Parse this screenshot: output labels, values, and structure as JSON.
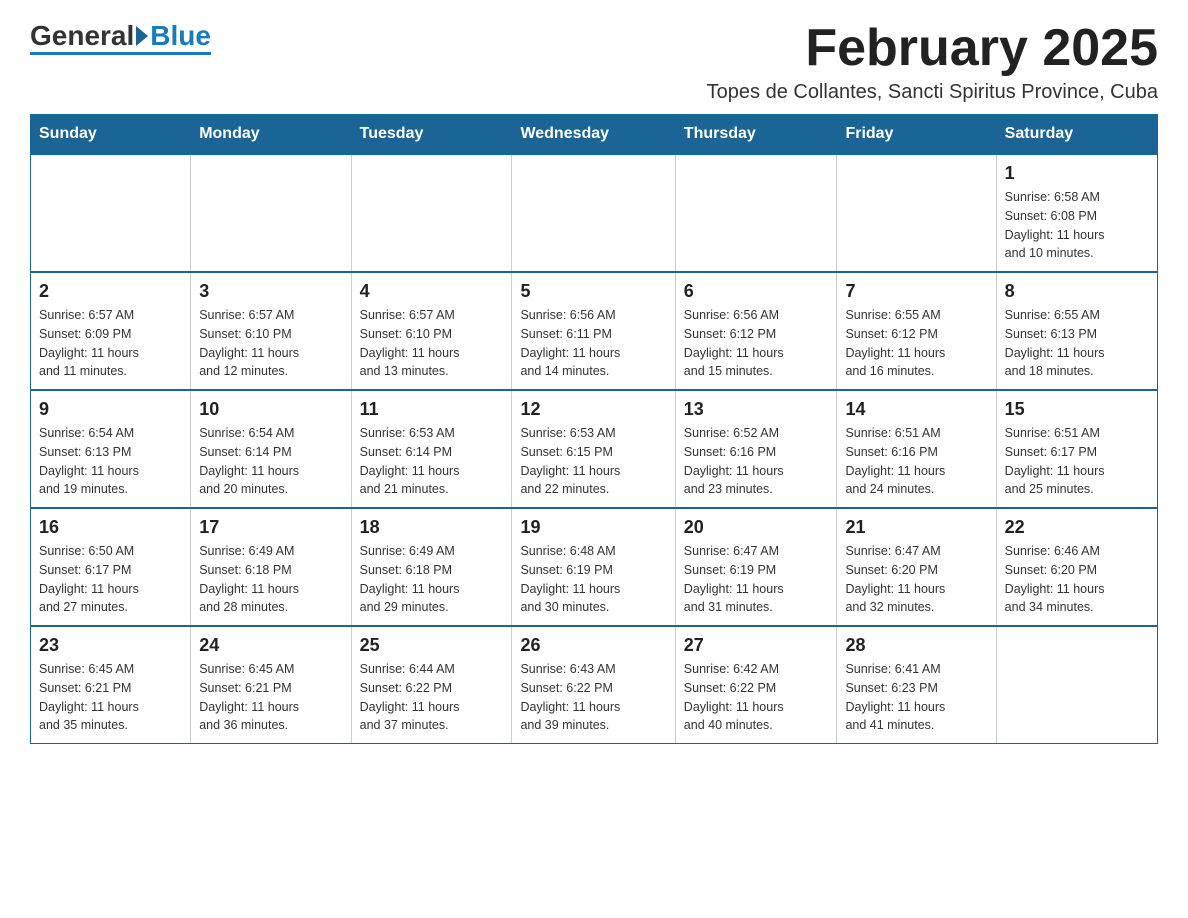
{
  "logo": {
    "general": "General",
    "blue": "Blue"
  },
  "header": {
    "month_title": "February 2025",
    "location": "Topes de Collantes, Sancti Spiritus Province, Cuba"
  },
  "weekdays": [
    "Sunday",
    "Monday",
    "Tuesday",
    "Wednesday",
    "Thursday",
    "Friday",
    "Saturday"
  ],
  "weeks": [
    [
      {
        "day": "",
        "info": ""
      },
      {
        "day": "",
        "info": ""
      },
      {
        "day": "",
        "info": ""
      },
      {
        "day": "",
        "info": ""
      },
      {
        "day": "",
        "info": ""
      },
      {
        "day": "",
        "info": ""
      },
      {
        "day": "1",
        "info": "Sunrise: 6:58 AM\nSunset: 6:08 PM\nDaylight: 11 hours\nand 10 minutes."
      }
    ],
    [
      {
        "day": "2",
        "info": "Sunrise: 6:57 AM\nSunset: 6:09 PM\nDaylight: 11 hours\nand 11 minutes."
      },
      {
        "day": "3",
        "info": "Sunrise: 6:57 AM\nSunset: 6:10 PM\nDaylight: 11 hours\nand 12 minutes."
      },
      {
        "day": "4",
        "info": "Sunrise: 6:57 AM\nSunset: 6:10 PM\nDaylight: 11 hours\nand 13 minutes."
      },
      {
        "day": "5",
        "info": "Sunrise: 6:56 AM\nSunset: 6:11 PM\nDaylight: 11 hours\nand 14 minutes."
      },
      {
        "day": "6",
        "info": "Sunrise: 6:56 AM\nSunset: 6:12 PM\nDaylight: 11 hours\nand 15 minutes."
      },
      {
        "day": "7",
        "info": "Sunrise: 6:55 AM\nSunset: 6:12 PM\nDaylight: 11 hours\nand 16 minutes."
      },
      {
        "day": "8",
        "info": "Sunrise: 6:55 AM\nSunset: 6:13 PM\nDaylight: 11 hours\nand 18 minutes."
      }
    ],
    [
      {
        "day": "9",
        "info": "Sunrise: 6:54 AM\nSunset: 6:13 PM\nDaylight: 11 hours\nand 19 minutes."
      },
      {
        "day": "10",
        "info": "Sunrise: 6:54 AM\nSunset: 6:14 PM\nDaylight: 11 hours\nand 20 minutes."
      },
      {
        "day": "11",
        "info": "Sunrise: 6:53 AM\nSunset: 6:14 PM\nDaylight: 11 hours\nand 21 minutes."
      },
      {
        "day": "12",
        "info": "Sunrise: 6:53 AM\nSunset: 6:15 PM\nDaylight: 11 hours\nand 22 minutes."
      },
      {
        "day": "13",
        "info": "Sunrise: 6:52 AM\nSunset: 6:16 PM\nDaylight: 11 hours\nand 23 minutes."
      },
      {
        "day": "14",
        "info": "Sunrise: 6:51 AM\nSunset: 6:16 PM\nDaylight: 11 hours\nand 24 minutes."
      },
      {
        "day": "15",
        "info": "Sunrise: 6:51 AM\nSunset: 6:17 PM\nDaylight: 11 hours\nand 25 minutes."
      }
    ],
    [
      {
        "day": "16",
        "info": "Sunrise: 6:50 AM\nSunset: 6:17 PM\nDaylight: 11 hours\nand 27 minutes."
      },
      {
        "day": "17",
        "info": "Sunrise: 6:49 AM\nSunset: 6:18 PM\nDaylight: 11 hours\nand 28 minutes."
      },
      {
        "day": "18",
        "info": "Sunrise: 6:49 AM\nSunset: 6:18 PM\nDaylight: 11 hours\nand 29 minutes."
      },
      {
        "day": "19",
        "info": "Sunrise: 6:48 AM\nSunset: 6:19 PM\nDaylight: 11 hours\nand 30 minutes."
      },
      {
        "day": "20",
        "info": "Sunrise: 6:47 AM\nSunset: 6:19 PM\nDaylight: 11 hours\nand 31 minutes."
      },
      {
        "day": "21",
        "info": "Sunrise: 6:47 AM\nSunset: 6:20 PM\nDaylight: 11 hours\nand 32 minutes."
      },
      {
        "day": "22",
        "info": "Sunrise: 6:46 AM\nSunset: 6:20 PM\nDaylight: 11 hours\nand 34 minutes."
      }
    ],
    [
      {
        "day": "23",
        "info": "Sunrise: 6:45 AM\nSunset: 6:21 PM\nDaylight: 11 hours\nand 35 minutes."
      },
      {
        "day": "24",
        "info": "Sunrise: 6:45 AM\nSunset: 6:21 PM\nDaylight: 11 hours\nand 36 minutes."
      },
      {
        "day": "25",
        "info": "Sunrise: 6:44 AM\nSunset: 6:22 PM\nDaylight: 11 hours\nand 37 minutes."
      },
      {
        "day": "26",
        "info": "Sunrise: 6:43 AM\nSunset: 6:22 PM\nDaylight: 11 hours\nand 39 minutes."
      },
      {
        "day": "27",
        "info": "Sunrise: 6:42 AM\nSunset: 6:22 PM\nDaylight: 11 hours\nand 40 minutes."
      },
      {
        "day": "28",
        "info": "Sunrise: 6:41 AM\nSunset: 6:23 PM\nDaylight: 11 hours\nand 41 minutes."
      },
      {
        "day": "",
        "info": ""
      }
    ]
  ]
}
